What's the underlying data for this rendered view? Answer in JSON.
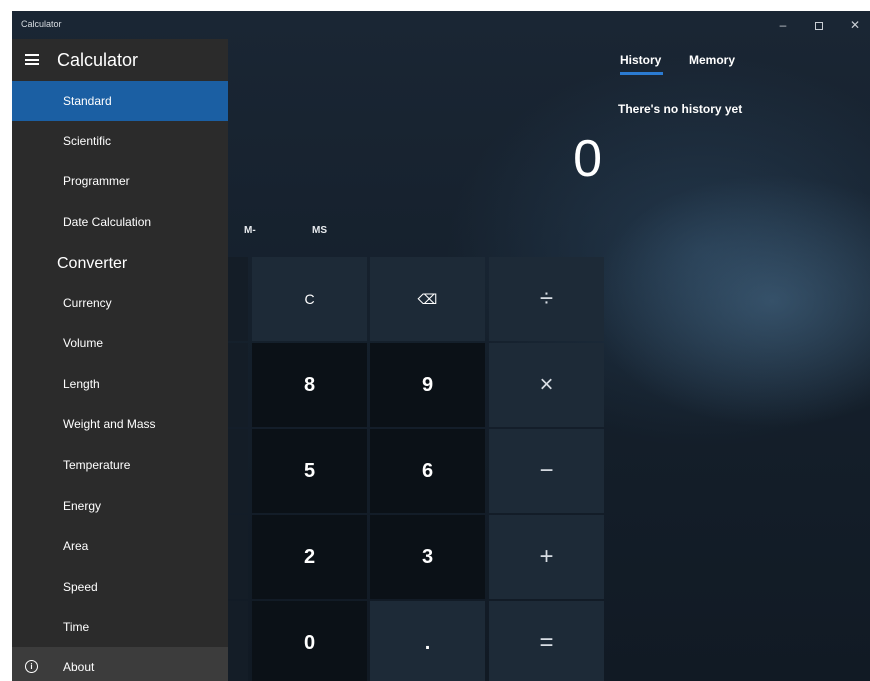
{
  "window": {
    "title": "Calculator",
    "controls": {
      "minimize": "–",
      "close": "✕"
    }
  },
  "nav": {
    "title": "Calculator",
    "calculator_items": [
      {
        "label": "Standard",
        "selected": true
      },
      {
        "label": "Scientific"
      },
      {
        "label": "Programmer"
      },
      {
        "label": "Date Calculation"
      }
    ],
    "converter_title": "Converter",
    "converter_items": [
      {
        "label": "Currency"
      },
      {
        "label": "Volume"
      },
      {
        "label": "Length"
      },
      {
        "label": "Weight and Mass"
      },
      {
        "label": "Temperature"
      },
      {
        "label": "Energy"
      },
      {
        "label": "Area"
      },
      {
        "label": "Speed"
      },
      {
        "label": "Time"
      }
    ],
    "about": {
      "label": "About",
      "icon": "info-icon"
    }
  },
  "calculator": {
    "display": "0",
    "memory": {
      "mminus": "M-",
      "ms": "MS"
    },
    "keys": {
      "clear": "C",
      "backspace": "⌫",
      "divide": "÷",
      "eight": "8",
      "nine": "9",
      "multiply": "×",
      "five": "5",
      "six": "6",
      "minus": "−",
      "two": "2",
      "three": "3",
      "plus": "+",
      "zero": "0",
      "decimal": ".",
      "equals": "="
    }
  },
  "history": {
    "tabs": {
      "history": "History",
      "memory": "Memory"
    },
    "empty_message": "There's no history yet"
  },
  "colors": {
    "accent": "#1b5fa3",
    "tab_underline": "#2b7bd2",
    "nav_background": "#2b2b2b",
    "number_key": "#0b1117",
    "operator_key": "#1d2a37"
  }
}
